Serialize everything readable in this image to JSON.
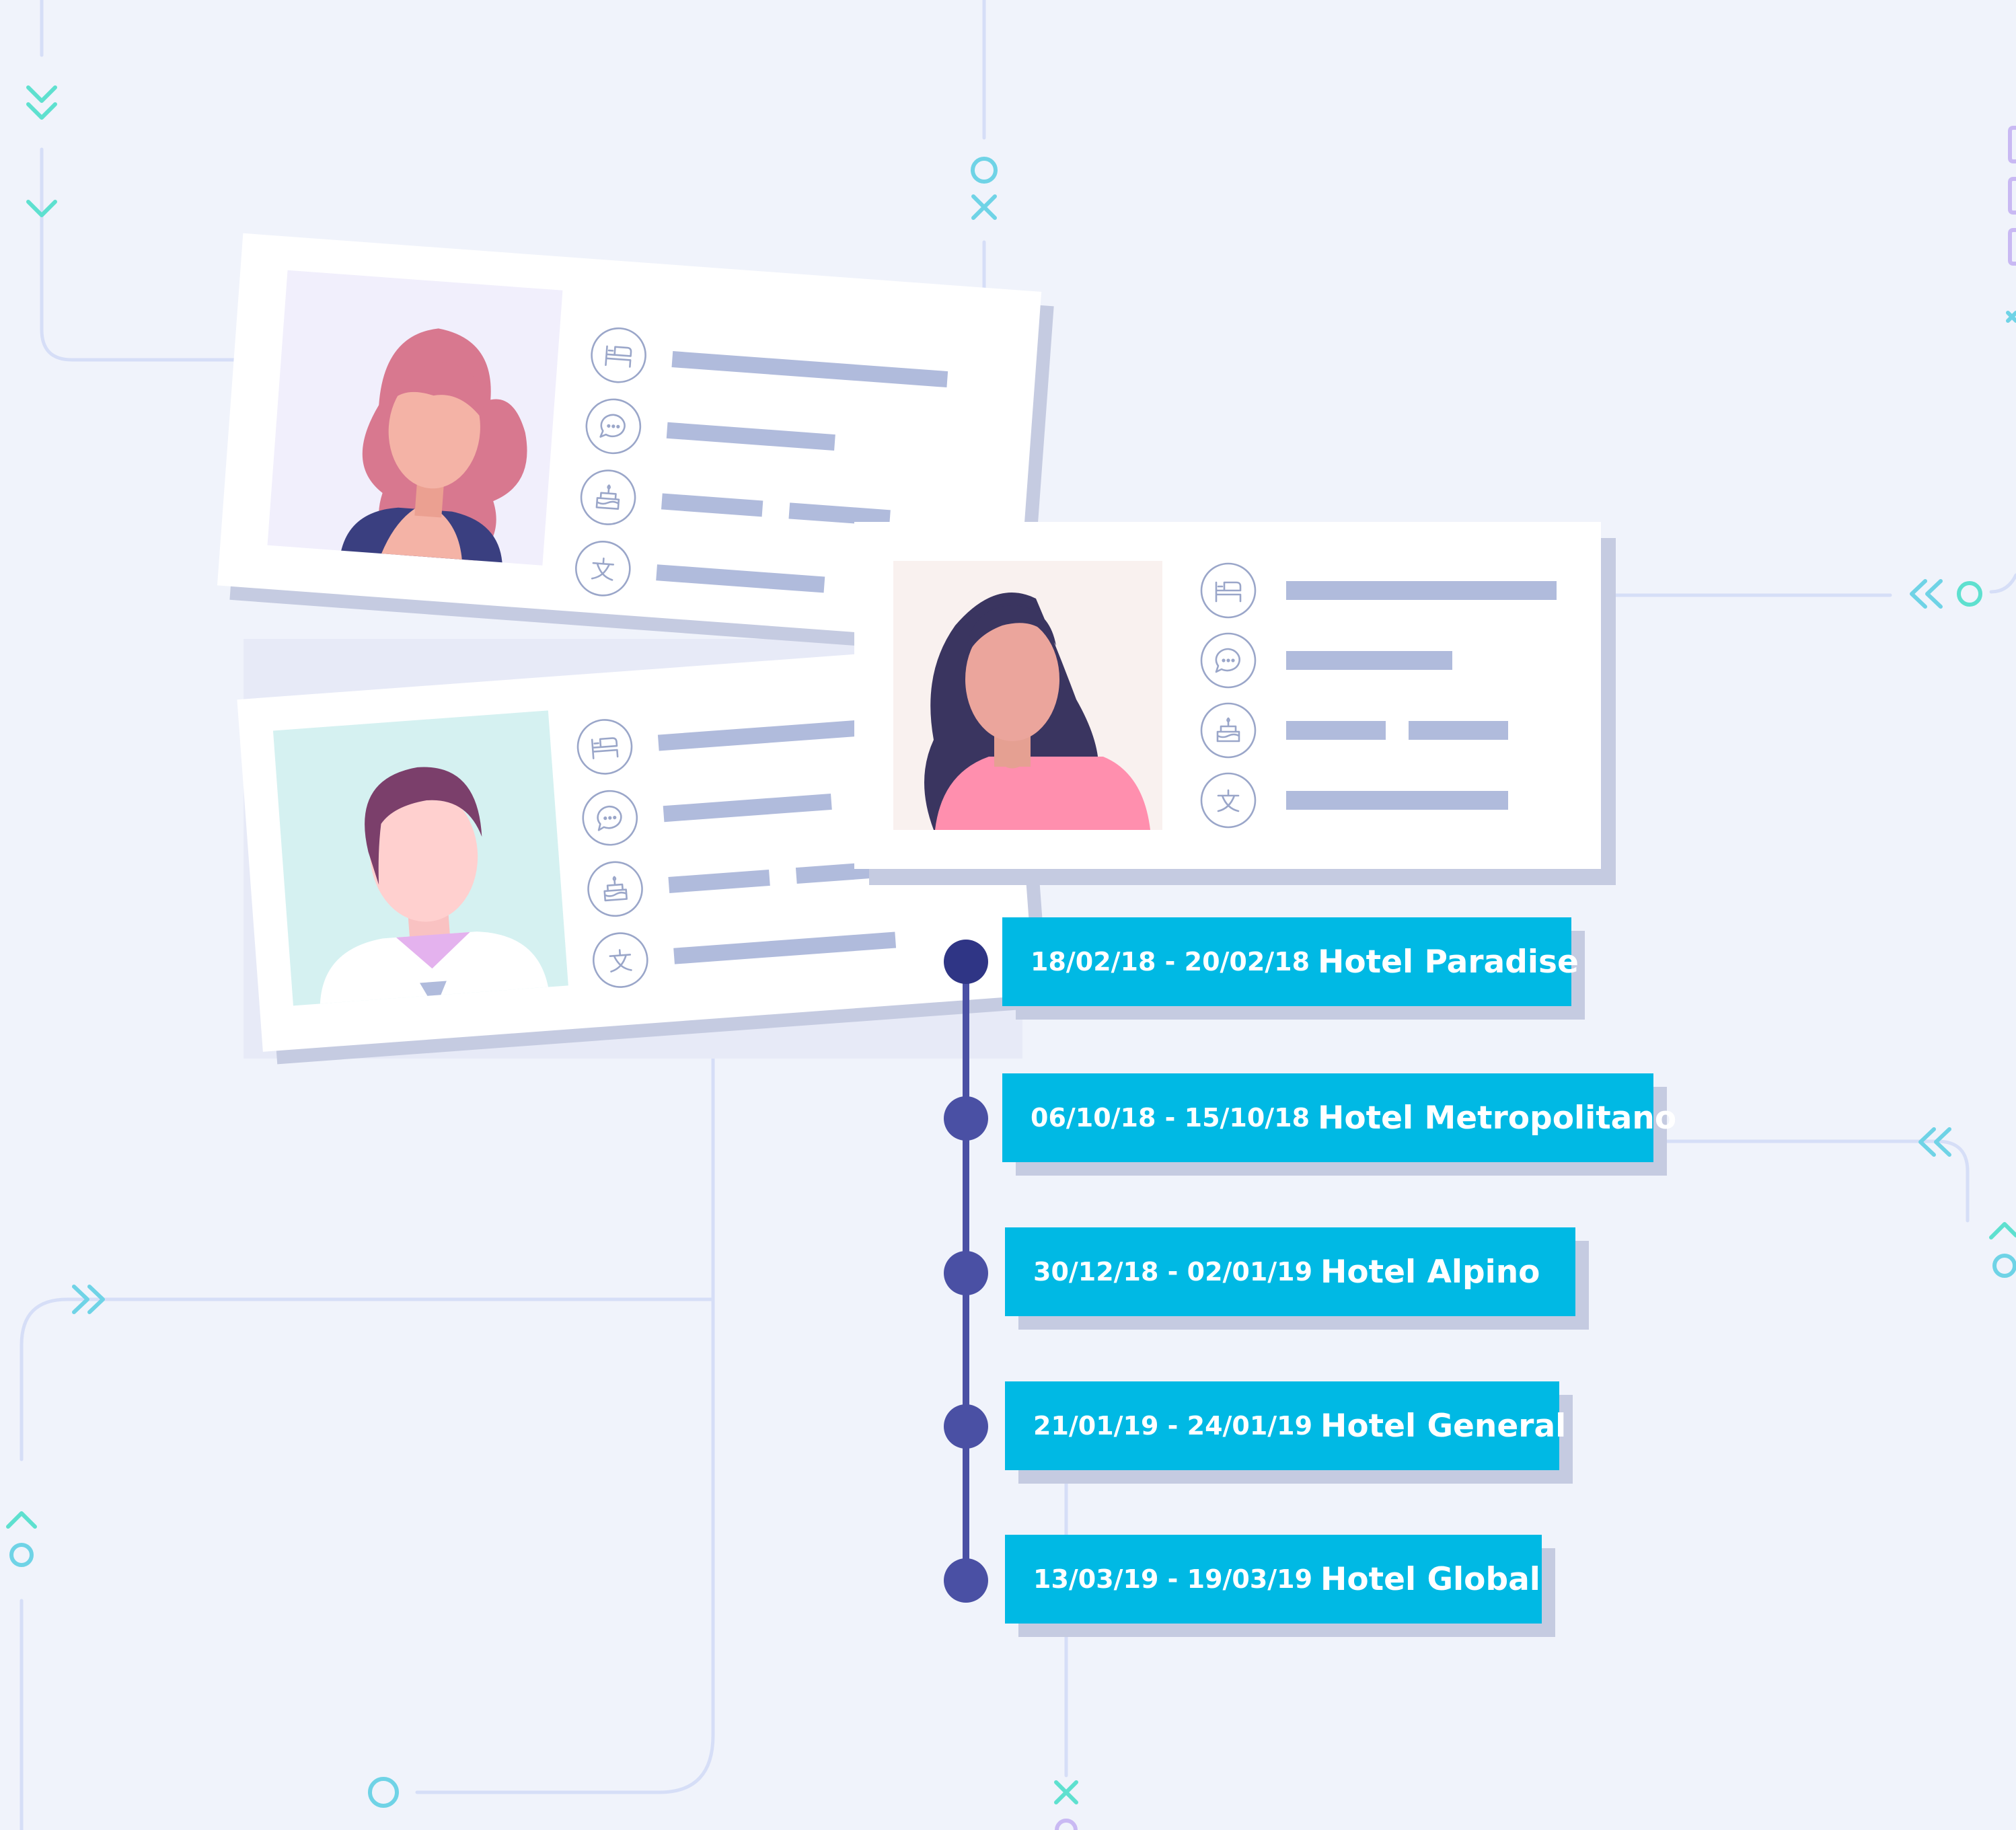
{
  "palette": {
    "background": "#f0f3fb",
    "connector_line": "#d6def7",
    "accent_teal": "#5ee0cf",
    "accent_cyan": "#6fd3e6",
    "accent_purple": "#c9b9f3",
    "card": "#ffffff",
    "card_shadow": "#c5cbe1",
    "placeholder_bar": "#b0bbdc",
    "icon_stroke": "#9aa6c9",
    "timeline": "#4a50a4",
    "entry_fill": "#00b9e4",
    "entry_shadow": "#c5cbe1",
    "entry_text": "#ffffff"
  },
  "profiles": [
    {
      "id": "profile-card-red-haired-woman",
      "icons": [
        "bed-icon",
        "chat-icon",
        "cake-icon",
        "language-icon"
      ]
    },
    {
      "id": "profile-card-man",
      "icons": [
        "bed-icon",
        "chat-icon",
        "cake-icon",
        "language-icon"
      ]
    },
    {
      "id": "profile-card-dark-haired-woman",
      "icons": [
        "bed-icon",
        "chat-icon",
        "cake-icon",
        "language-icon"
      ]
    }
  ],
  "timeline": {
    "entries": [
      {
        "dates": "18/02/18 - 20/02/18",
        "hotel": "Hotel Paradise"
      },
      {
        "dates": "06/10/18 - 15/10/18",
        "hotel": "Hotel Metropolitano"
      },
      {
        "dates": "30/12/18 - 02/01/19",
        "hotel": "Hotel Alpino"
      },
      {
        "dates": "21/01/19 - 24/01/19",
        "hotel": "Hotel General"
      },
      {
        "dates": "13/03/19 - 19/03/19",
        "hotel": "Hotel Global"
      }
    ]
  }
}
